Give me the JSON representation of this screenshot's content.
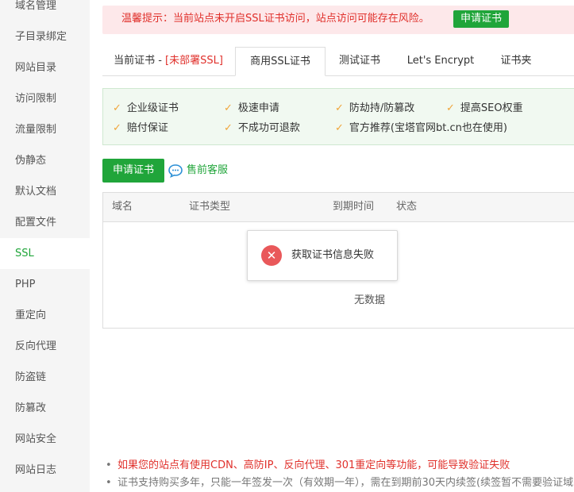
{
  "sidebar": {
    "items": [
      {
        "label": "域名管理",
        "active": false
      },
      {
        "label": "子目录绑定",
        "active": false
      },
      {
        "label": "网站目录",
        "active": false
      },
      {
        "label": "访问限制",
        "active": false
      },
      {
        "label": "流量限制",
        "active": false
      },
      {
        "label": "伪静态",
        "active": false
      },
      {
        "label": "默认文档",
        "active": false
      },
      {
        "label": "配置文件",
        "active": false
      },
      {
        "label": "SSL",
        "active": true
      },
      {
        "label": "PHP",
        "active": false
      },
      {
        "label": "重定向",
        "active": false
      },
      {
        "label": "反向代理",
        "active": false
      },
      {
        "label": "防盗链",
        "active": false
      },
      {
        "label": "防篡改",
        "active": false
      },
      {
        "label": "网站安全",
        "active": false
      },
      {
        "label": "网站日志",
        "active": false
      }
    ]
  },
  "warning": {
    "text": "温馨提示：当前站点未开启SSL证书访问，站点访问可能存在风险。",
    "button": "申请证书"
  },
  "tabs": {
    "current_prefix": "当前证书 - ",
    "current_status": "[未部署SSL]",
    "commercial": "商用SSL证书",
    "test": "测试证书",
    "letsencrypt": "Let's Encrypt",
    "folder": "证书夹"
  },
  "features": [
    "企业级证书",
    "极速申请",
    "防劫持/防篡改",
    "提高SEO权重",
    "赔付保证",
    "不成功可退款",
    "官方推荐(宝塔官网bt.cn也在使用)"
  ],
  "actions": {
    "apply": "申请证书",
    "service": "售前客服"
  },
  "table": {
    "headers": [
      "域名",
      "证书类型",
      "到期时间",
      "状态"
    ],
    "empty": "无数据"
  },
  "popup": {
    "message": "获取证书信息失败"
  },
  "notes": [
    "如果您的站点有使用CDN、高防IP、反向代理、301重定向等功能，可能导致验证失败",
    "证书支持购买多年，只能一年签发一次（有效期一年），需在到期前30天内续签(续签暂不需要验证域名)"
  ],
  "colors": {
    "accent": "#20a53a",
    "danger": "#e0302b",
    "warning_bg": "#fde8ea",
    "feature_bg": "#f1f9f1",
    "check": "#f0a53a"
  }
}
